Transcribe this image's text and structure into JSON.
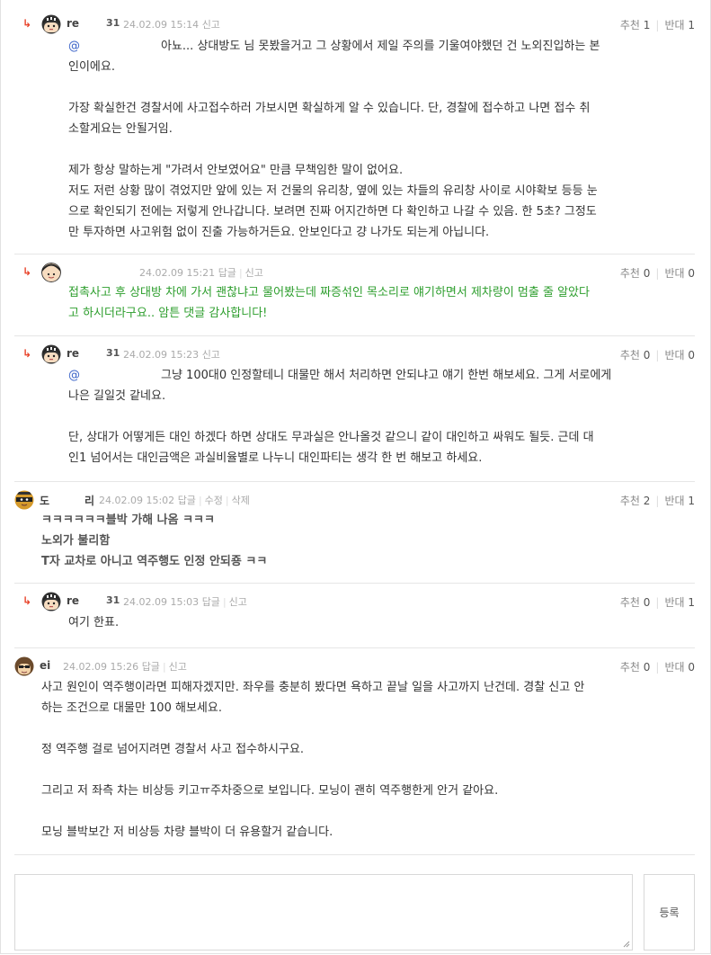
{
  "comments": [
    {
      "nick": "re",
      "level": "31",
      "date": "24.02.09 15:14",
      "actions": [
        "신고"
      ],
      "up_label": "추천",
      "up_count": "1",
      "down_label": "반대",
      "down_count": "1",
      "mention": "@",
      "first_line": "아뇨... 상대방도 님 못봤을거고 그 상황에서 제일 주의를 기울여야했던 건 노외진입하는 본",
      "rest": "인이에요.\n\n가장 확실한건 경찰서에 사고접수하러 가보시면 확실하게 알 수 있습니다. 단, 경찰에 접수하고 나면 접수 취\n소할게요는 안될거임.\n\n제가 항상 말하는게 \"가려서 안보였어요\" 만큼 무책임한 말이 없어요.\n저도 저런 상황 많이 겪었지만 앞에 있는 저 건물의 유리창, 옆에 있는 차들의 유리창 사이로 시야확보 등등 눈\n으로 확인되기 전에는 저렇게 안나갑니다. 보려면 진짜 어지간하면 다 확인하고 나갈 수 있음. 한 5초? 그정도\n만 투자하면 사고위험 없이 진출 가능하거든요. 안보인다고 걍 나가도 되는게 아닙니다."
    },
    {
      "nick": "",
      "level": "",
      "date": "24.02.09 15:21",
      "actions": [
        "답글",
        "신고"
      ],
      "up_label": "추천",
      "up_count": "0",
      "down_label": "반대",
      "down_count": "0",
      "text": "접촉사고 후 상대방 차에 가서 괜찮냐고 물어봤는데 짜증섞인 목소리로 얘기하면서 제차량이 멈출 줄 알았다\n고 하시더라구요.. 암튼 댓글 감사합니다!"
    },
    {
      "nick": "re",
      "level": "31",
      "date": "24.02.09 15:23",
      "actions": [
        "신고"
      ],
      "up_label": "추천",
      "up_count": "0",
      "down_label": "반대",
      "down_count": "0",
      "mention": "@",
      "first_line": "그냥 100대0 인정할테니 대물만 해서 처리하면 안되냐고 얘기 한번 해보세요. 그게 서로에게",
      "rest": "나은 길일것 같네요.\n\n단, 상대가 어떻게든 대인 하겠다 하면 상대도 무과실은 안나올것 같으니 같이 대인하고 싸워도 될듯. 근데 대\n인1 넘어서는 대인금액은 과실비율별로 나누니 대인파티는 생각 한 번 해보고 하세요."
    },
    {
      "nick": "도",
      "nick2": "리",
      "date": "24.02.09 15:02",
      "actions": [
        "답글",
        "수정",
        "삭제"
      ],
      "up_label": "추천",
      "up_count": "2",
      "down_label": "반대",
      "down_count": "1",
      "text": "ㅋㅋㅋㅋㅋㅋ블박 가해 나옴 ㅋㅋㅋ\n노외가 불리함\nT자 교차로 아니고 역주행도 인정 안되죵 ㅋㅋ"
    },
    {
      "nick": "re",
      "level": "31",
      "date": "24.02.09 15:03",
      "actions": [
        "답글",
        "신고"
      ],
      "up_label": "추천",
      "up_count": "0",
      "down_label": "반대",
      "down_count": "1",
      "text": "여기 한표."
    },
    {
      "nick": "ei",
      "date": "24.02.09 15:26",
      "actions": [
        "답글",
        "신고"
      ],
      "up_label": "추천",
      "up_count": "0",
      "down_label": "반대",
      "down_count": "0",
      "text": "사고 원인이 역주행이라면 피해자겠지만. 좌우를 충분히 봤다면 욕하고 끝날 일을 사고까지 난건데. 경찰 신고 안\n하는 조건으로 대물만 100 해보세요.\n\n정 역주행 걸로 넘어지려면 경찰서 사고 접수하시구요.\n\n그리고 저 좌측 차는 비상등 키고ㅠ주차중으로 보입니다. 모닝이 괜히 역주행한게 안거 같아요.\n\n모닝 블박보간 저 비상등 차량 블박이 더 유용할거 같습니다."
    }
  ],
  "reply_arrow": "↳",
  "submit_label": "등록",
  "colors": {
    "accent_red": "#e8452c",
    "mention_blue": "#3a63c8",
    "reply_green": "#2d9e2d"
  }
}
